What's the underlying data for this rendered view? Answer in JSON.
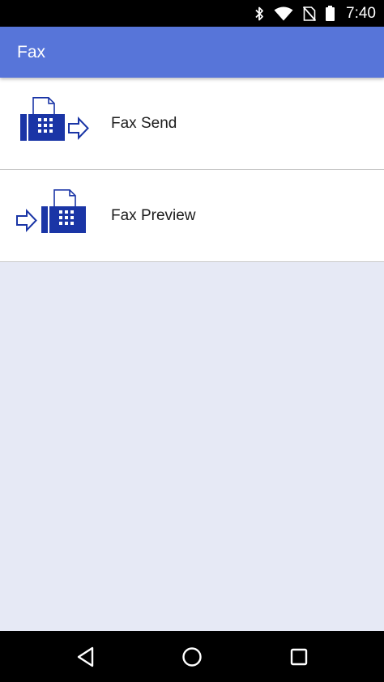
{
  "status_bar": {
    "time": "7:40",
    "icons": [
      "bluetooth-icon",
      "wifi-icon",
      "no-sim-icon",
      "battery-icon"
    ]
  },
  "app_bar": {
    "title": "Fax"
  },
  "menu": {
    "items": [
      {
        "label": "Fax Send",
        "icon": "fax-send-icon"
      },
      {
        "label": "Fax Preview",
        "icon": "fax-preview-icon"
      }
    ]
  },
  "nav_bar": {
    "buttons": [
      "back-icon",
      "home-icon",
      "recents-icon"
    ]
  },
  "colors": {
    "app_bar": "#5775d9",
    "icon_blue": "#1a35a6",
    "background": "#e6e9f5"
  }
}
